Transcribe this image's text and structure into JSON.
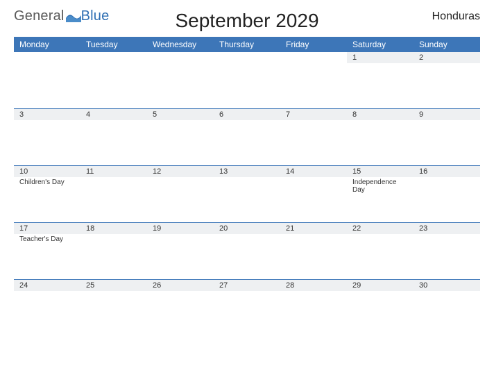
{
  "brand": {
    "part1": "General",
    "part2": "Blue"
  },
  "title": "September 2029",
  "country": "Honduras",
  "days": [
    "Monday",
    "Tuesday",
    "Wednesday",
    "Thursday",
    "Friday",
    "Saturday",
    "Sunday"
  ],
  "weeks": [
    [
      {
        "date": "",
        "event": ""
      },
      {
        "date": "",
        "event": ""
      },
      {
        "date": "",
        "event": ""
      },
      {
        "date": "",
        "event": ""
      },
      {
        "date": "",
        "event": ""
      },
      {
        "date": "1",
        "event": ""
      },
      {
        "date": "2",
        "event": ""
      }
    ],
    [
      {
        "date": "3",
        "event": ""
      },
      {
        "date": "4",
        "event": ""
      },
      {
        "date": "5",
        "event": ""
      },
      {
        "date": "6",
        "event": ""
      },
      {
        "date": "7",
        "event": ""
      },
      {
        "date": "8",
        "event": ""
      },
      {
        "date": "9",
        "event": ""
      }
    ],
    [
      {
        "date": "10",
        "event": "Children's Day"
      },
      {
        "date": "11",
        "event": ""
      },
      {
        "date": "12",
        "event": ""
      },
      {
        "date": "13",
        "event": ""
      },
      {
        "date": "14",
        "event": ""
      },
      {
        "date": "15",
        "event": "Independence Day"
      },
      {
        "date": "16",
        "event": ""
      }
    ],
    [
      {
        "date": "17",
        "event": "Teacher's Day"
      },
      {
        "date": "18",
        "event": ""
      },
      {
        "date": "19",
        "event": ""
      },
      {
        "date": "20",
        "event": ""
      },
      {
        "date": "21",
        "event": ""
      },
      {
        "date": "22",
        "event": ""
      },
      {
        "date": "23",
        "event": ""
      }
    ],
    [
      {
        "date": "24",
        "event": ""
      },
      {
        "date": "25",
        "event": ""
      },
      {
        "date": "26",
        "event": ""
      },
      {
        "date": "27",
        "event": ""
      },
      {
        "date": "28",
        "event": ""
      },
      {
        "date": "29",
        "event": ""
      },
      {
        "date": "30",
        "event": ""
      }
    ]
  ]
}
